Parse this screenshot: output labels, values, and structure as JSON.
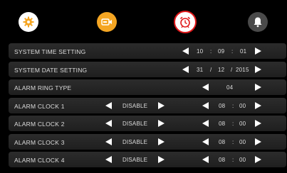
{
  "header": {
    "icons": [
      {
        "name": "settings-gear-icon",
        "color": "#f5a623"
      },
      {
        "name": "video-camera-icon",
        "color": "#f5a623"
      },
      {
        "name": "alarm-clock-icon",
        "color": "#e0191b"
      },
      {
        "name": "bell-icon",
        "color": "#ffffff"
      }
    ]
  },
  "settings": {
    "time": {
      "label": "SYSTEM TIME SETTING",
      "hour": "10",
      "minute": "09",
      "second": "01",
      "sep": ":"
    },
    "date": {
      "label": "SYSTEM DATE SETTING",
      "day": "31",
      "month": "12",
      "year": "2015",
      "sep": "/"
    },
    "ring": {
      "label": "ALARM RING TYPE",
      "value": "04"
    },
    "alarms": [
      {
        "label": "ALARM CLOCK 1",
        "state": "DISABLE",
        "hour": "08",
        "minute": "00",
        "sep": ":"
      },
      {
        "label": "ALARM CLOCK 2",
        "state": "DISABLE",
        "hour": "08",
        "minute": "00",
        "sep": ":"
      },
      {
        "label": "ALARM CLOCK 3",
        "state": "DISABLE",
        "hour": "08",
        "minute": "00",
        "sep": ":"
      },
      {
        "label": "ALARM CLOCK 4",
        "state": "DISABLE",
        "hour": "08",
        "minute": "00",
        "sep": ":"
      }
    ]
  }
}
